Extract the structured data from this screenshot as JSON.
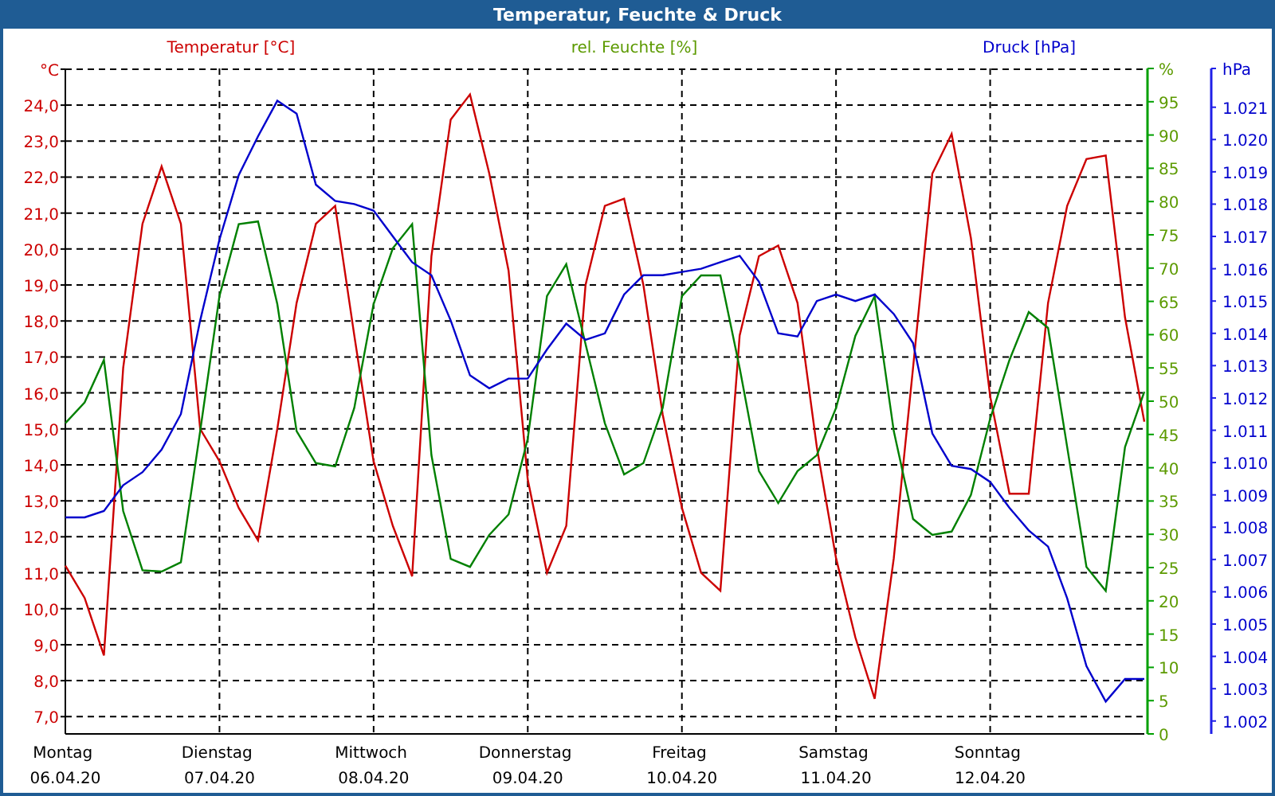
{
  "window": {
    "title": "Temperatur, Feuchte & Druck"
  },
  "charts": [
    {
      "chart_data": {
        "type": "line",
        "grid": true,
        "ylabel": "Temperatur [°C]",
        "ylim": [
          6.52,
          25.02
        ],
        "categories": [
          "Montag 06.04.20",
          null,
          null,
          null,
          null,
          null,
          null,
          null,
          "Dienstag 07.04.20",
          null,
          null,
          null,
          null,
          null,
          null,
          null,
          "Mittwoch 08.04.20",
          null,
          null,
          null,
          null,
          null,
          null,
          null,
          "Donnerstag 09.04.20",
          null,
          null,
          null,
          null,
          null,
          null,
          null,
          "Freitag 10.04.20",
          null,
          null,
          null,
          null,
          null,
          null,
          null,
          "Samstag 11.04.20",
          null,
          null,
          null,
          null,
          null,
          null,
          null,
          "Sonntag 12.04.20",
          null,
          null,
          null,
          null,
          null,
          null,
          null,
          null
        ],
        "yticks": [
          {
            "value": 7,
            "label": "7,0"
          },
          {
            "value": 8,
            "label": "8,0"
          },
          {
            "value": 9,
            "label": "9,0"
          },
          {
            "value": 10,
            "label": "10,0"
          },
          {
            "value": 11,
            "label": "11,0"
          },
          {
            "value": 12,
            "label": "12,0"
          },
          {
            "value": 13,
            "label": "13,0"
          },
          {
            "value": 14,
            "label": "14,0"
          },
          {
            "value": 15,
            "label": "15,0"
          },
          {
            "value": 16,
            "label": "16,0"
          },
          {
            "value": 17,
            "label": "17,0"
          },
          {
            "value": 18,
            "label": "18,0"
          },
          {
            "value": 19,
            "label": "19,0"
          },
          {
            "value": 20,
            "label": "20,0"
          },
          {
            "value": 21,
            "label": "21,0"
          },
          {
            "value": 22,
            "label": "22,0"
          },
          {
            "value": 23,
            "label": "23,0"
          },
          {
            "value": 24,
            "label": "24,0"
          },
          {
            "value": 25,
            "label": "°C"
          }
        ],
        "series": [
          {
            "color": "#cc0000",
            "values": [
              11.2,
              10.3,
              8.7,
              16.7,
              20.7,
              22.3,
              20.7,
              15.0,
              14.1,
              12.8,
              11.9,
              15.0,
              18.5,
              20.7,
              21.2,
              17.6,
              14.1,
              12.3,
              10.9,
              19.8,
              23.6,
              24.3,
              22.1,
              19.4,
              13.6,
              11.0,
              12.3,
              19.0,
              21.2,
              21.4,
              19.0,
              15.4,
              12.8,
              11.0,
              10.5,
              17.6,
              19.8,
              20.1,
              18.5,
              14.5,
              11.4,
              9.2,
              7.5,
              11.4,
              16.7,
              22.1,
              23.2,
              20.3,
              15.9,
              13.2,
              13.2,
              18.5,
              21.2,
              22.5,
              22.6,
              18.1,
              15.2
            ]
          }
        ]
      }
    },
    {
      "chart_data": {
        "type": "line",
        "ylabel": "rel. Feuchte [%]",
        "ylim": [
          0,
          100
        ],
        "categories": [
          null,
          null,
          null,
          null,
          null,
          null,
          null,
          null,
          null,
          null,
          null,
          null,
          null,
          null,
          null,
          null,
          null,
          null,
          null,
          null,
          null,
          null,
          null,
          null,
          null,
          null,
          null,
          null,
          null,
          null,
          null,
          null,
          null,
          null,
          null,
          null,
          null,
          null,
          null,
          null,
          null,
          null,
          null,
          null,
          null,
          null,
          null,
          null,
          null,
          null,
          null,
          null,
          null,
          null,
          null,
          null,
          null
        ],
        "yticks": [
          0,
          5,
          10,
          15,
          20,
          25,
          30,
          35,
          40,
          45,
          50,
          55,
          60,
          65,
          70,
          75,
          80,
          85,
          90,
          95,
          {
            "value": 100,
            "label": "%"
          }
        ],
        "series": [
          {
            "color": "#008000",
            "values": [
              46.7,
              49.8,
              56.2,
              33.5,
              24.6,
              24.4,
              25.8,
              45.5,
              65.8,
              76.6,
              77.0,
              64.6,
              45.5,
              40.7,
              40.2,
              49.0,
              64.6,
              73.0,
              76.6,
              41.9,
              26.3,
              25.1,
              29.9,
              33.0,
              44.3,
              65.8,
              70.6,
              58.6,
              46.7,
              39.0,
              40.7,
              49.0,
              65.8,
              68.9,
              68.9,
              55.0,
              39.5,
              34.7,
              39.5,
              41.9,
              49.0,
              59.8,
              65.8,
              45.5,
              32.3,
              29.9,
              30.4,
              35.9,
              47.4,
              56.2,
              63.4,
              61.0,
              43.1,
              25.1,
              21.5,
              43.1,
              51.4
            ]
          }
        ]
      }
    },
    {
      "chart_data": {
        "type": "line",
        "ylabel": "Druck [hPa]",
        "ylim": [
          1001.6,
          1022.2
        ],
        "categories": [
          null,
          null,
          null,
          null,
          null,
          null,
          null,
          null,
          null,
          null,
          null,
          null,
          null,
          null,
          null,
          null,
          null,
          null,
          null,
          null,
          null,
          null,
          null,
          null,
          null,
          null,
          null,
          null,
          null,
          null,
          null,
          null,
          null,
          null,
          null,
          null,
          null,
          null,
          null,
          null,
          null,
          null,
          null,
          null,
          null,
          null,
          null,
          null,
          null,
          null,
          null,
          null,
          null,
          null,
          null,
          null,
          null
        ],
        "yticks": [
          {
            "value": 1002,
            "label": "1.002"
          },
          {
            "value": 1003,
            "label": "1.003"
          },
          {
            "value": 1004,
            "label": "1.004"
          },
          {
            "value": 1005,
            "label": "1.005"
          },
          {
            "value": 1006,
            "label": "1.006"
          },
          {
            "value": 1007,
            "label": "1.007"
          },
          {
            "value": 1008,
            "label": "1.008"
          },
          {
            "value": 1009,
            "label": "1.009"
          },
          {
            "value": 1010,
            "label": "1.010"
          },
          {
            "value": 1011,
            "label": "1.011"
          },
          {
            "value": 1012,
            "label": "1.012"
          },
          {
            "value": 1013,
            "label": "1.013"
          },
          {
            "value": 1014,
            "label": "1.014"
          },
          {
            "value": 1015,
            "label": "1.015"
          },
          {
            "value": 1016,
            "label": "1.016"
          },
          {
            "value": 1017,
            "label": "1.017"
          },
          {
            "value": 1018,
            "label": "1.018"
          },
          {
            "value": 1019,
            "label": "1.019"
          },
          {
            "value": 1020,
            "label": "1.020"
          },
          {
            "value": 1021,
            "label": "1.021"
          },
          {
            "value": 1022.2,
            "label": "hPa"
          }
        ],
        "series": [
          {
            "color": "#0000cc",
            "values": [
              1008.3,
              1008.3,
              1008.5,
              1009.3,
              1009.7,
              1010.4,
              1011.5,
              1014.4,
              1016.9,
              1018.9,
              1020.1,
              1021.2,
              1020.8,
              1018.6,
              1018.1,
              1018.0,
              1017.8,
              1017.0,
              1016.2,
              1015.8,
              1014.4,
              1012.7,
              1012.3,
              1012.6,
              1012.6,
              1013.5,
              1014.3,
              1013.8,
              1014.0,
              1015.2,
              1015.8,
              1015.8,
              1015.9,
              1016.0,
              1016.2,
              1016.4,
              1015.6,
              1014.0,
              1013.9,
              1015.0,
              1015.2,
              1015.0,
              1015.2,
              1014.6,
              1013.7,
              1010.9,
              1009.9,
              1009.8,
              1009.4,
              1008.6,
              1007.9,
              1007.4,
              1005.8,
              1003.7,
              1002.6,
              1003.3,
              1003.3
            ]
          }
        ]
      }
    }
  ]
}
